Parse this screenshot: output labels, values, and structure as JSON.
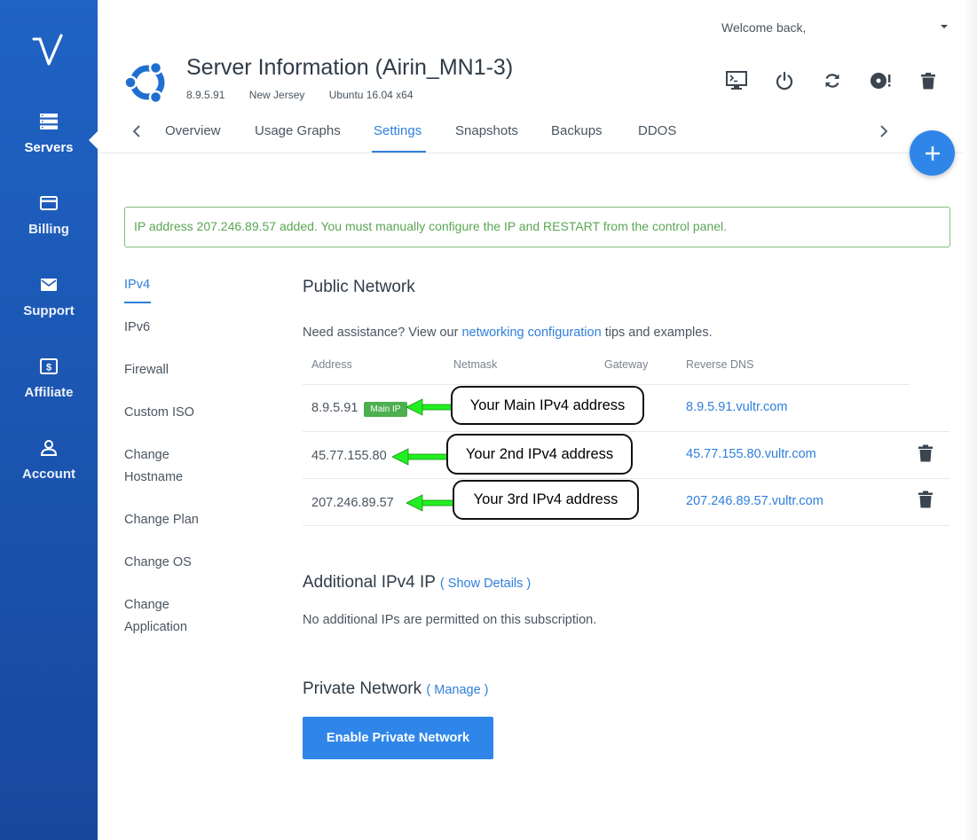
{
  "header": {
    "welcome_text": "Welcome back,",
    "title": "Server Information (Airin_MN1-3)",
    "ip": "8.9.5.91",
    "location": "New Jersey",
    "os": "Ubuntu 16.04 x64",
    "os_icon": "ubuntu-logo-icon",
    "actions": [
      {
        "icon": "console-icon",
        "label": "View Console"
      },
      {
        "icon": "power-icon",
        "label": "Server Stop"
      },
      {
        "icon": "restart-icon",
        "label": "Server Restart"
      },
      {
        "icon": "reinstall-icon",
        "label": "Server Reinstall"
      },
      {
        "icon": "trash-icon",
        "label": "Server Destroy"
      }
    ]
  },
  "sidebar": {
    "items": [
      {
        "label": "Servers",
        "icon": "servers-icon",
        "active": true
      },
      {
        "label": "Billing",
        "icon": "card-icon"
      },
      {
        "label": "Support",
        "icon": "mail-icon"
      },
      {
        "label": "Affiliate",
        "icon": "dollar-icon"
      },
      {
        "label": "Account",
        "icon": "user-icon"
      }
    ]
  },
  "tabs": [
    "Overview",
    "Usage Graphs",
    "Settings",
    "Snapshots",
    "Backups",
    "DDOS"
  ],
  "active_tab": "Settings",
  "alert": "IP address 207.246.89.57 added. You must manually configure the IP and RESTART from the control panel.",
  "subnav": [
    "IPv4",
    "IPv6",
    "Firewall",
    "Custom ISO",
    "Change Hostname",
    "Change Plan",
    "Change OS",
    "Change Application"
  ],
  "subnav_active": "IPv4",
  "public_network": {
    "title": "Public Network",
    "help_prefix": "Need assistance? View our",
    "help_link": "networking configuration",
    "help_suffix": "tips and examples.",
    "columns": [
      "Address",
      "Netmask",
      "Gateway",
      "Reverse DNS"
    ],
    "rows": [
      {
        "address": "8.9.5.91",
        "badge": "Main IP",
        "reverse_dns": "8.9.5.91.vultr.com",
        "annotation": "Your Main IPv4 address",
        "deletable": false
      },
      {
        "address": "45.77.155.80",
        "reverse_dns": "45.77.155.80.vultr.com",
        "annotation": "Your 2nd IPv4 address",
        "deletable": true
      },
      {
        "address": "207.246.89.57",
        "reverse_dns": "207.246.89.57.vultr.com",
        "annotation": "Your 3rd IPv4 address",
        "deletable": true
      }
    ]
  },
  "additional_ipv4": {
    "title": "Additional IPv4 IP",
    "link": "( Show Details )",
    "text": "No additional IPs are permitted on this subscription."
  },
  "private_network": {
    "title": "Private Network",
    "link": "( Manage )",
    "button": "Enable Private Network"
  },
  "colors": {
    "accent": "#2f7fdc",
    "sidebar_top": "#1f63c4",
    "sidebar_bottom": "#17489e",
    "success": "#5aa654",
    "badge": "#4caf50",
    "arrow": "#22ee22"
  }
}
